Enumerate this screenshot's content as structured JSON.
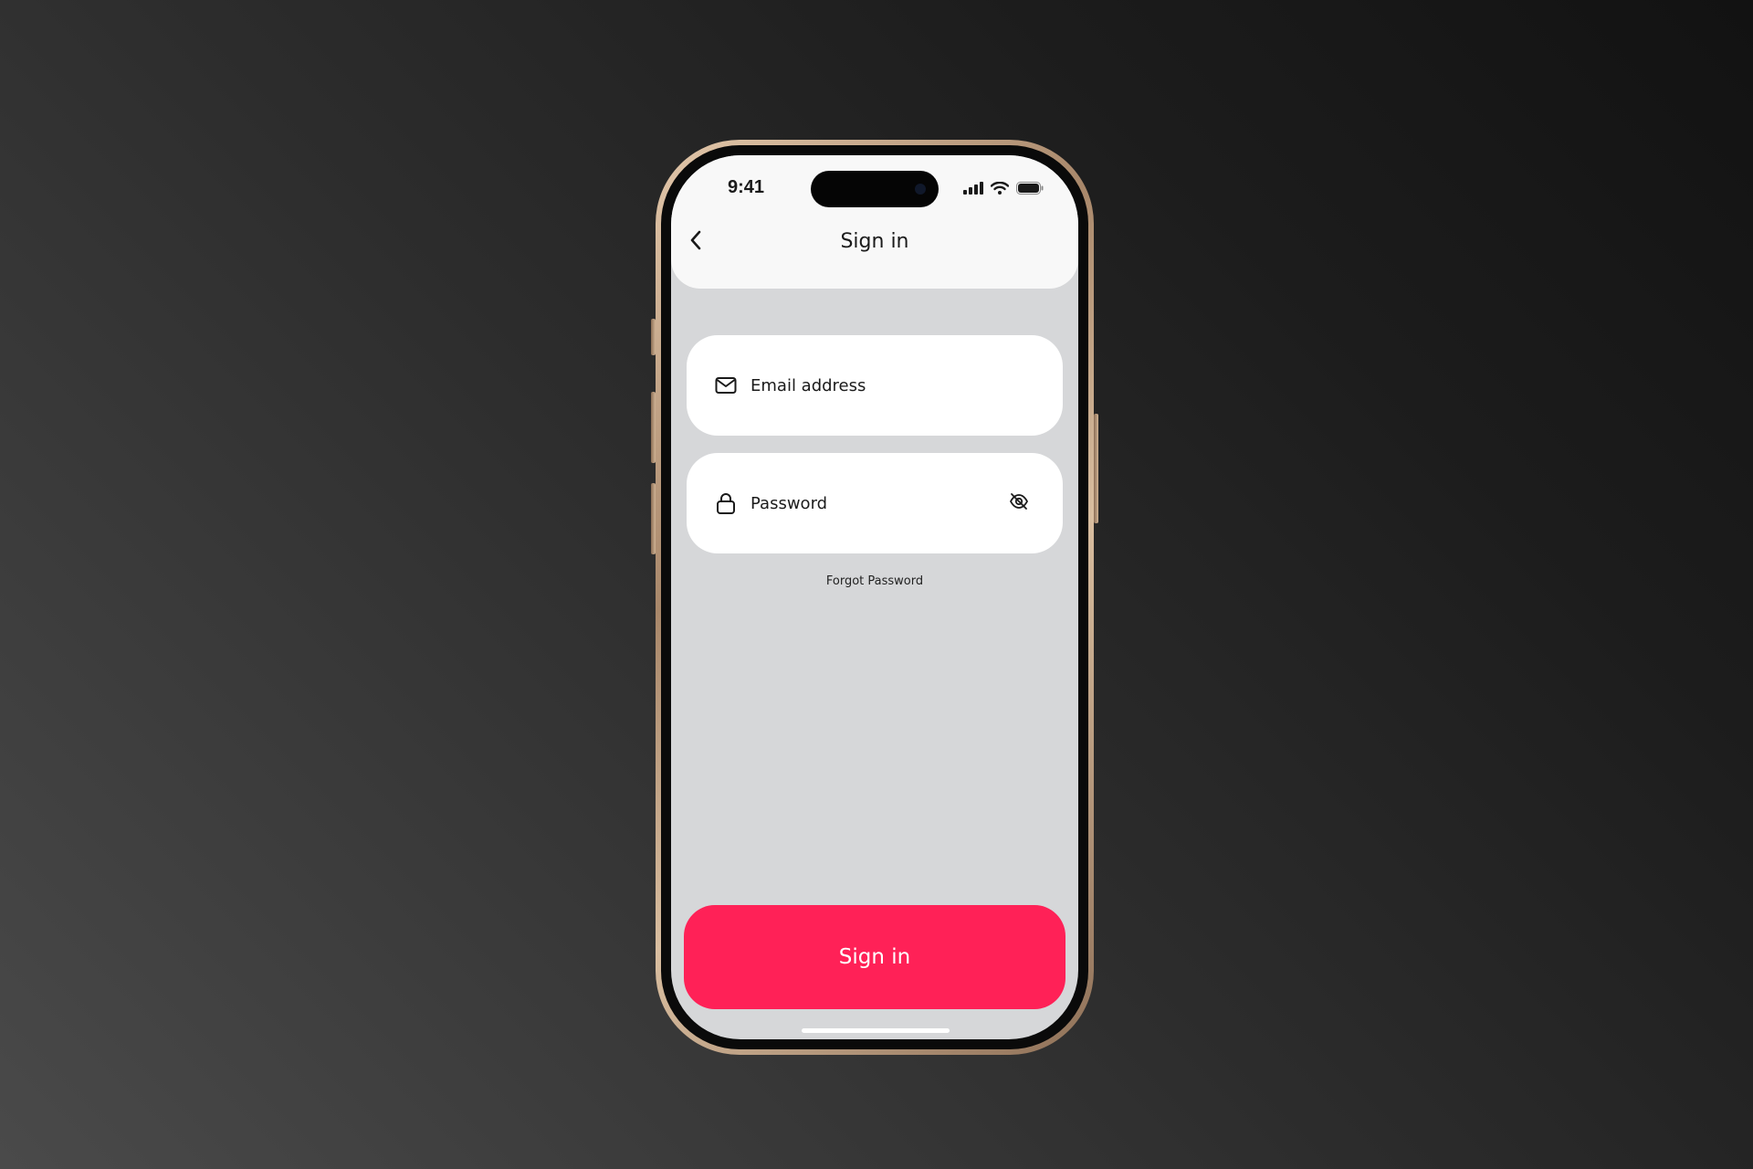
{
  "status_bar": {
    "time": "9:41",
    "icons": [
      "cellular-signal-icon",
      "wifi-icon",
      "battery-icon"
    ]
  },
  "header": {
    "back_icon": "chevron-left-icon",
    "title": "Sign in"
  },
  "form": {
    "email": {
      "icon": "mail-icon",
      "placeholder": "Email address",
      "value": ""
    },
    "password": {
      "icon": "lock-icon",
      "placeholder": "Password",
      "value": "",
      "toggle_icon": "eye-off-icon"
    },
    "forgot_label": "Forgot Password"
  },
  "cta": {
    "label": "Sign in"
  },
  "colors": {
    "accent": "#ff2157",
    "screen_bg": "#d6d7d9",
    "card_bg": "#ffffff",
    "header_bg": "#f8f8f8"
  }
}
